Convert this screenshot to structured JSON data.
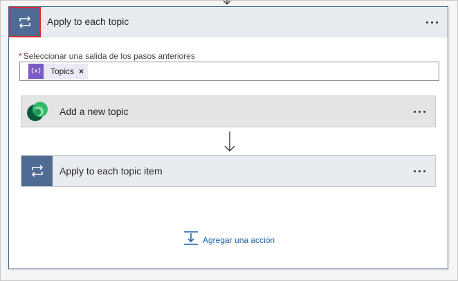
{
  "card": {
    "title": "Apply to each topic",
    "icon": "loop-icon",
    "more_icon": "more-icon"
  },
  "field": {
    "required_mark": "*",
    "label": "Seleccionar una salida de los pasos anteriores",
    "token": {
      "icon": "expression-icon",
      "icon_text": "{x}",
      "label": "Topics",
      "remove": "×"
    }
  },
  "actions": [
    {
      "title": "Add a new topic",
      "icon": "dataverse-icon"
    },
    {
      "title": "Apply to each topic item",
      "icon": "loop-icon"
    }
  ],
  "add_action": {
    "label": "Agregar una acción",
    "icon": "insert-step-icon"
  },
  "colors": {
    "header_bg": "#e8ebf0",
    "loop_icon_bg": "#4e6b94",
    "highlight_outline": "#e0272c",
    "token_icon_bg": "#7b5cc6",
    "token_bg": "#ece8f6",
    "link": "#1f5fa8",
    "required": "#c4262e"
  }
}
